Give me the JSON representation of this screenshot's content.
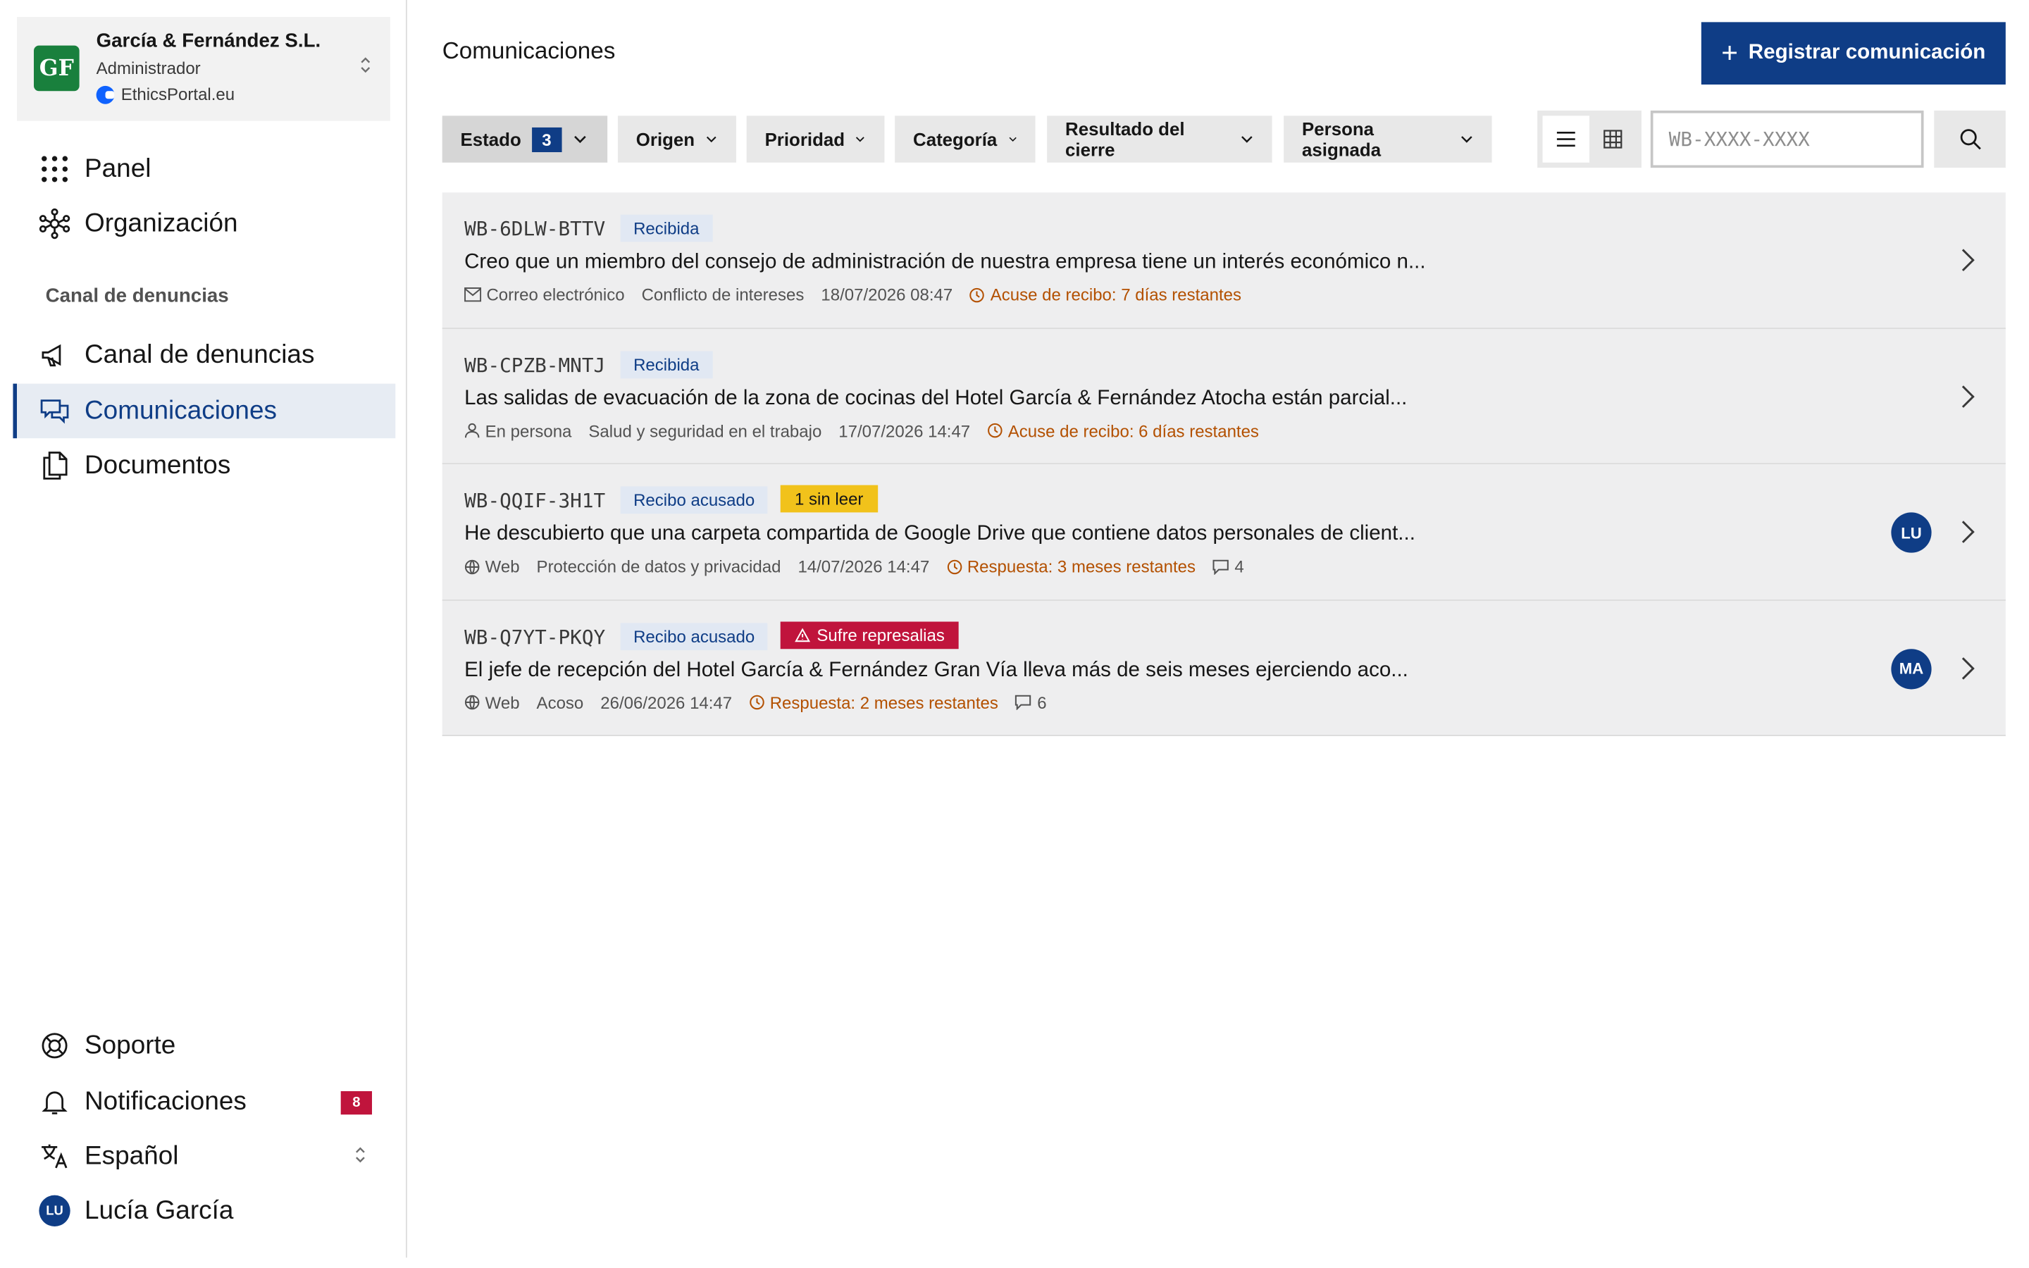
{
  "org": {
    "logo": "GF",
    "name": "García & Fernández S.L.",
    "role": "Administrador",
    "portal": "EthicsPortal.eu"
  },
  "nav": {
    "panel": "Panel",
    "organizacion": "Organización",
    "section": "Canal de denuncias",
    "canal": "Canal de denuncias",
    "comunicaciones": "Comunicaciones",
    "documentos": "Documentos"
  },
  "footer_nav": {
    "soporte": "Soporte",
    "notificaciones": "Notificaciones",
    "notifications_count": "8",
    "idioma": "Español",
    "user_initials": "LU",
    "user_name": "Lucía García"
  },
  "header": {
    "title": "Comunicaciones",
    "primary_action": "Registrar comunicación"
  },
  "filters": {
    "estado": "Estado",
    "estado_count": "3",
    "origen": "Origen",
    "prioridad": "Prioridad",
    "categoria": "Categoría",
    "resultado": "Resultado del cierre",
    "persona": "Persona asignada"
  },
  "search": {
    "placeholder": "WB-XXXX-XXXX"
  },
  "reports": [
    {
      "code": "WB-6DLW-BTTV",
      "status": "Recibida",
      "summary": "Creo que un miembro del consejo de administración de nuestra empresa tiene un interés económico n...",
      "channel": "Correo electrónico",
      "channel_icon": "mail-icon",
      "category": "Conflicto de intereses",
      "date": "18/07/2026 08:47",
      "deadline": "Acuse de recibo: 7 días restantes"
    },
    {
      "code": "WB-CPZB-MNTJ",
      "status": "Recibida",
      "summary": "Las salidas de evacuación de la zona de cocinas del Hotel García & Fernández Atocha están parcial...",
      "channel": "En persona",
      "channel_icon": "person-icon",
      "category": "Salud y seguridad en el trabajo",
      "date": "17/07/2026 14:47",
      "deadline": "Acuse de recibo: 6 días restantes"
    },
    {
      "code": "WB-QQIF-3H1T",
      "status": "Recibo acusado",
      "tag": "1 sin leer",
      "summary": "He descubierto que una carpeta compartida de Google Drive que contiene datos personales de client...",
      "channel": "Web",
      "channel_icon": "globe-icon",
      "category": "Protección de datos y privacidad",
      "date": "14/07/2026 14:47",
      "deadline": "Respuesta: 3 meses restantes",
      "messages": "4",
      "assignee": "LU"
    },
    {
      "code": "WB-Q7YT-PKQY",
      "status": "Recibo acusado",
      "tag": "Sufre represalias",
      "summary": "El jefe de recepción del Hotel García & Fernández Gran Vía lleva más de seis meses ejerciendo aco...",
      "channel": "Web",
      "channel_icon": "globe-icon",
      "category": "Acoso",
      "date": "26/06/2026 14:47",
      "deadline": "Respuesta: 2 meses restantes",
      "messages": "6",
      "assignee": "MA"
    }
  ],
  "colors": {
    "primary": "#0f3d86",
    "logo_green": "#19803d",
    "unread": "#f1c21b",
    "danger": "#c0143c",
    "deadline": "#b35000"
  }
}
